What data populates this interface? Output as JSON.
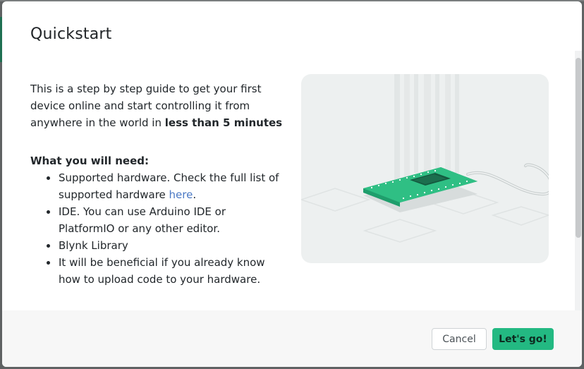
{
  "modal": {
    "title": "Quickstart",
    "intro_text": "This is a step by step guide to get your first device online and start controlling it from anywhere in the world in ",
    "intro_bold": "less than 5 minutes",
    "requirements_title": "What you will need:",
    "requirements": [
      {
        "text": "Supported hardware. Check the full list of supported hardware ",
        "link": "here",
        "suffix": "."
      },
      {
        "text": "IDE. You can use Arduino IDE or PlatformIO or any other editor."
      },
      {
        "text": "Blynk Library"
      },
      {
        "text": "It will be beneficial if you already know how to upload code to your hardware."
      }
    ],
    "illustration": "hardware-board-illustration"
  },
  "footer": {
    "cancel_label": "Cancel",
    "go_label": "Let's go!"
  },
  "colors": {
    "accent": "#23b982",
    "link": "#4a78c4",
    "board": "#2fbf84"
  }
}
